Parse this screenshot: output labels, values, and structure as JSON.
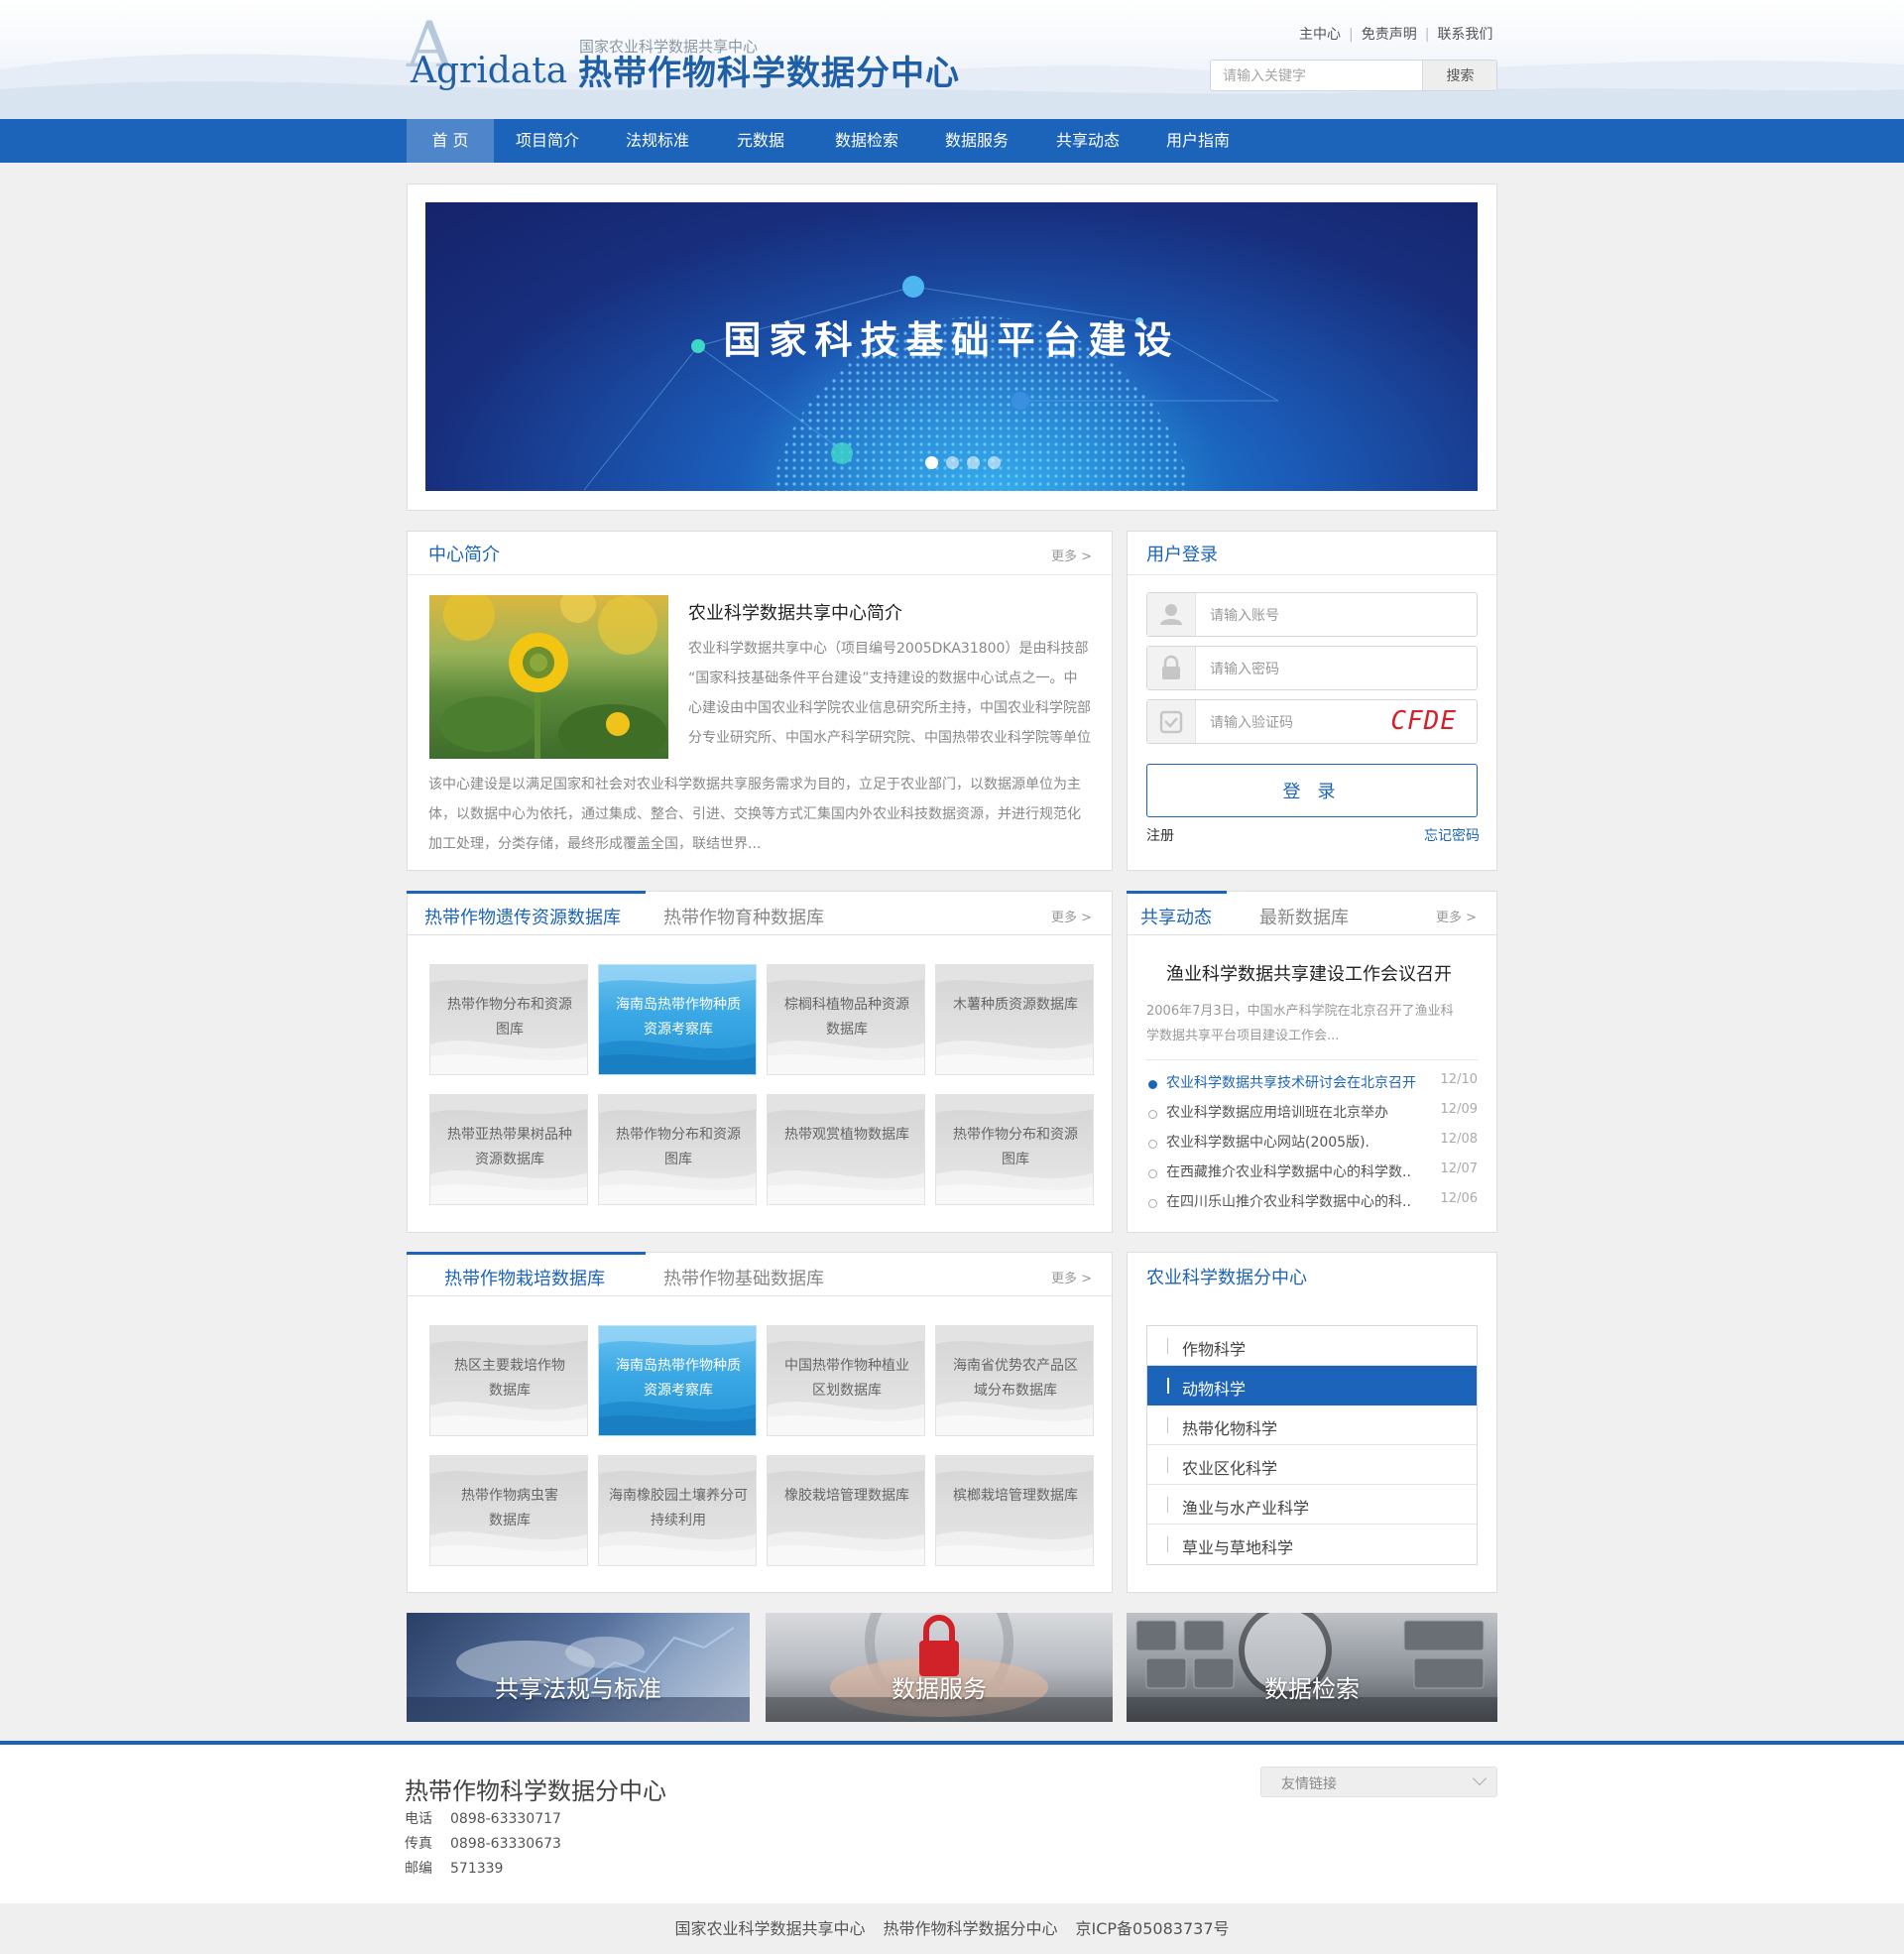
{
  "header": {
    "logo_letter": "A",
    "logo_word": "Agridata",
    "subtitle": "国家农业科学数据共享中心",
    "title": "热带作物科学数据分中心",
    "top_links": [
      "主中心",
      "免责声明",
      "联系我们"
    ],
    "search_placeholder": "请输入关键字",
    "search_button": "搜索"
  },
  "nav": [
    "首 页",
    "项目简介",
    "法规标准",
    "元数据",
    "数据检索",
    "数据服务",
    "共享动态",
    "用户指南"
  ],
  "banner": {
    "text": "国家科技基础平台建设",
    "slides_total": 4,
    "active_slide": 1
  },
  "intro": {
    "title": "中心简介",
    "more": "更多 >",
    "heading": "农业科学数据共享中心简介",
    "lines_side": [
      "农业科学数据共享中心（项目编号2005DKA31800）是由科技部",
      "“国家科技基础条件平台建设”支持建设的数据中心试点之一。中",
      "心建设由中国农业科学院农业信息研究所主持，中国农业科学院部",
      "分专业研究所、中国水产科学研究院、中国热带农业科学院等单位"
    ],
    "lines_full": [
      "该中心建设是以满足国家和社会对农业科学数据共享服务需求为目的，立足于农业部门，以数据源单位为主",
      "体，以数据中心为依托，通过集成、整合、引进、交换等方式汇集国内外农业科技数据资源，并进行规范化",
      "加工处理，分类存储，最终形成覆盖全国，联结世界..."
    ]
  },
  "login": {
    "title": "用户登录",
    "account_placeholder": "请输入账号",
    "password_placeholder": "请输入密码",
    "captcha_placeholder": "请输入验证码",
    "captcha_text": "CFDE",
    "button": "登 录",
    "register": "注册",
    "forgot": "忘记密码"
  },
  "genetic": {
    "tabs": [
      "热带作物遗传资源数据库",
      "热带作物育种数据库"
    ],
    "more": "更多 >",
    "tiles": [
      [
        "热带作物分布和资源",
        "图库"
      ],
      [
        "海南岛热带作物种质",
        "资源考察库"
      ],
      [
        "棕榈科植物品种资源",
        "数据库"
      ],
      [
        "木薯种质资源数据库",
        ""
      ],
      [
        "热带亚热带果树品种",
        "资源数据库"
      ],
      [
        "热带作物分布和资源",
        "图库"
      ],
      [
        "热带观赏植物数据库",
        ""
      ],
      [
        "热带作物分布和资源",
        "图库"
      ]
    ]
  },
  "news": {
    "tabs": [
      "共享动态",
      "最新数据库"
    ],
    "more": "更多 >",
    "headline": "渔业科学数据共享建设工作会议召开",
    "summary": [
      "2006年7月3日，中国水产科学院在北京召开了渔业科",
      "学数据共享平台项目建设工作会..."
    ],
    "items": [
      {
        "title": "农业科学数据共享技术研讨会在北京召开",
        "date": "12/10"
      },
      {
        "title": "农业科学数据应用培训班在北京举办",
        "date": "12/09"
      },
      {
        "title": "农业科学数据中心网站(2005版).",
        "date": "12/08"
      },
      {
        "title": "在西藏推介农业科学数据中心的科学数..",
        "date": "12/07"
      },
      {
        "title": "在四川乐山推介农业科学数据中心的科..",
        "date": "12/06"
      }
    ]
  },
  "cultivation": {
    "tabs": [
      "热带作物栽培数据库",
      "热带作物基础数据库"
    ],
    "more": "更多 >",
    "tiles": [
      [
        "热区主要栽培作物",
        "数据库"
      ],
      [
        "海南岛热带作物种质",
        "资源考察库"
      ],
      [
        "中国热带作物种植业",
        "区划数据库"
      ],
      [
        "海南省优势农产品区",
        "域分布数据库"
      ],
      [
        "热带作物病虫害",
        "数据库"
      ],
      [
        "海南橡胶园土壤养分可",
        "持续利用"
      ],
      [
        "橡胶栽培管理数据库",
        ""
      ],
      [
        "槟榔栽培管理数据库",
        ""
      ]
    ]
  },
  "subcenters": {
    "title": "农业科学数据分中心",
    "items": [
      "作物科学",
      "动物科学",
      "热带化物科学",
      "农业区化科学",
      "渔业与水产业科学",
      "草业与草地科学"
    ],
    "active_index": 1
  },
  "features": [
    "共享法规与标准",
    "数据服务",
    "数据检索"
  ],
  "footer": {
    "name": "热带作物科学数据分中心",
    "phone_label": "电话",
    "phone": "0898-63330717",
    "fax_label": "传真",
    "fax": "0898-63330673",
    "zip_label": "邮编",
    "zip": "571339",
    "friend_links": "友情链接",
    "copyright": [
      "国家农业科学数据共享中心",
      "热带作物科学数据分中心",
      "京ICP备05083737号"
    ]
  },
  "colors": {
    "primary": "#1c64b9",
    "nav_active": "#4f86c9",
    "tile_highlight": "#2d9fe0",
    "captcha": "#d3232a"
  }
}
